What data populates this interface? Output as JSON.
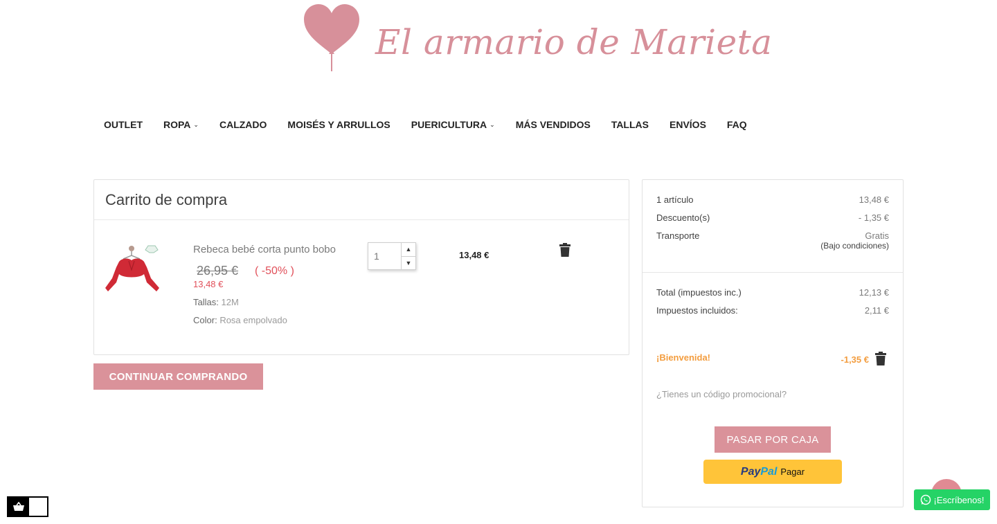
{
  "header": {
    "logo_text": "El armario de Marieta",
    "brand_color": "#d7909a"
  },
  "nav": {
    "items": [
      {
        "label": "OUTLET",
        "has_dropdown": false
      },
      {
        "label": "ROPA",
        "has_dropdown": true
      },
      {
        "label": "CALZADO",
        "has_dropdown": false
      },
      {
        "label": "MOISÉS Y ARRULLOS",
        "has_dropdown": false
      },
      {
        "label": "PUERICULTURA",
        "has_dropdown": true
      },
      {
        "label": "MÁS VENDIDOS",
        "has_dropdown": false
      },
      {
        "label": "TALLAS",
        "has_dropdown": false
      },
      {
        "label": "ENVÍOS",
        "has_dropdown": false
      },
      {
        "label": "FAQ",
        "has_dropdown": false
      }
    ]
  },
  "cart": {
    "title": "Carrito de compra",
    "item": {
      "name": "Rebeca bebé corta punto bobo",
      "regular_price": "26,95 €",
      "discount": "( -50% )",
      "price": "13,48 €",
      "size_label": "Tallas:",
      "size_value": "12M",
      "color_label": "Color:",
      "color_value": "Rosa empolvado",
      "quantity": "1",
      "line_total": "13,48 €",
      "thumb_icon": "red-cardigan-thumbnail"
    },
    "continue_label": "CONTINUAR COMPRANDO"
  },
  "summary": {
    "items_label": "1 artículo",
    "items_value": "13,48 €",
    "discount_label": "Descuento(s)",
    "discount_value": "- 1,35 €",
    "shipping_label": "Transporte",
    "shipping_value": "Gratis",
    "shipping_note": "(Bajo condiciones)",
    "total_label": "Total (impuestos inc.)",
    "total_value": "12,13 €",
    "tax_label": "Impuestos incluidos:",
    "tax_value": "2,11 €",
    "voucher_name": "¡Bienvenida!",
    "voucher_value": "-1,35 €",
    "promo_link": "¿Tienes un código promocional?",
    "checkout_label": "PASAR POR CAJA",
    "paypal_brand_a": "Pay",
    "paypal_brand_b": "Pal",
    "paypal_label": "Pagar"
  },
  "widgets": {
    "whatsapp_label": "¡Escríbenos!",
    "whatsapp_color": "#25d366"
  },
  "colors": {
    "accent": "#da929a",
    "sale": "#e1505a",
    "voucher": "#f39d3f"
  }
}
